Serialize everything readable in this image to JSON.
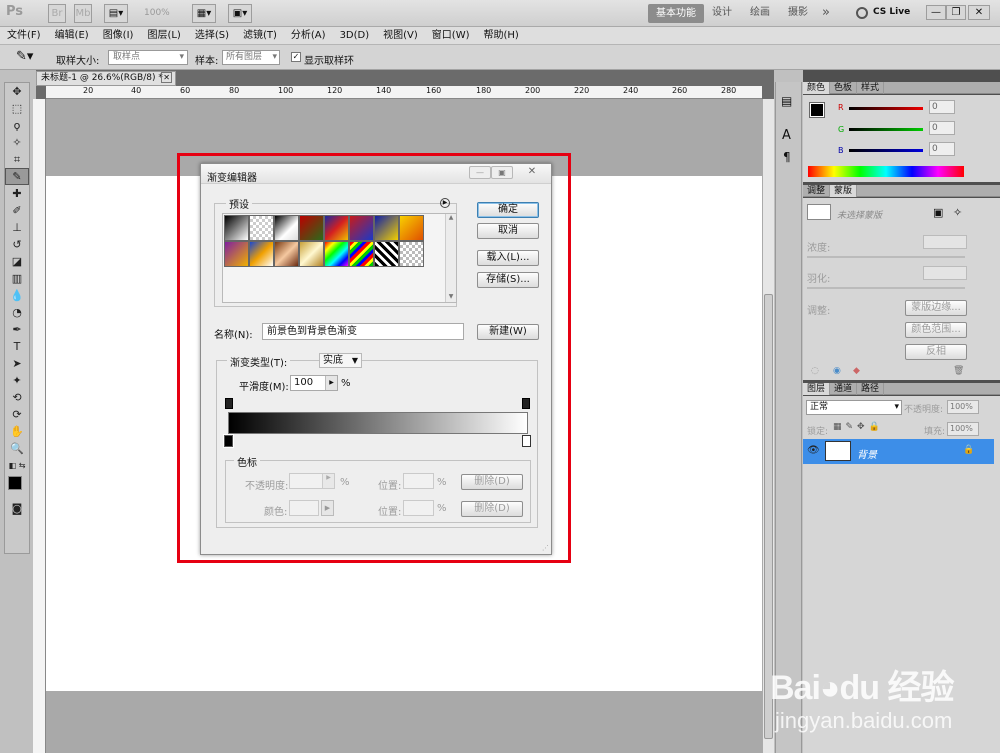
{
  "app": {
    "logo": "Ps",
    "zoom": "100%"
  },
  "workspace": {
    "active": "基本功能",
    "items": [
      "设计",
      "绘画",
      "摄影"
    ],
    "more": "»",
    "cslive": "CS Live"
  },
  "menu": [
    "文件(F)",
    "编辑(E)",
    "图像(I)",
    "图层(L)",
    "选择(S)",
    "滤镜(T)",
    "分析(A)",
    "3D(D)",
    "视图(V)",
    "窗口(W)",
    "帮助(H)"
  ],
  "options": {
    "sample_size_label": "取样大小:",
    "sample_size_value": "取样点",
    "sample_label": "样本:",
    "sample_value": "所有图层",
    "show_ring_label": "显示取样环"
  },
  "document": {
    "tab_title": "未标题-1 @ 26.6%(RGB/8) *",
    "ruler_h": [
      "20",
      "40",
      "60",
      "80",
      "100",
      "120",
      "140",
      "160",
      "180",
      "200",
      "220",
      "240",
      "260",
      "280"
    ]
  },
  "dialog": {
    "title": "渐变编辑器",
    "presets_label": "预设",
    "ok": "确定",
    "cancel": "取消",
    "load": "载入(L)...",
    "save": "存储(S)...",
    "name_label": "名称(N):",
    "name_value": "前景色到背景色渐变",
    "new_btn": "新建(W)",
    "type_label": "渐变类型(T):",
    "type_value": "实底",
    "smooth_label": "平滑度(M):",
    "smooth_value": "100",
    "percent": "%",
    "stops_label": "色标",
    "opacity_label": "不透明度:",
    "location_label": "位置:",
    "delete_btn": "删除(D)",
    "color_label": "颜色:",
    "preset_swatches": [
      "linear-gradient(135deg,#000,#fff)",
      "repeating-conic-gradient(#ccc 0 25%,#fff 0 50%) 0 0/6px 6px",
      "linear-gradient(135deg,#000,#fff 60%,#ddd)",
      "linear-gradient(135deg,#b00,#2a6b1a)",
      "linear-gradient(135deg,#1a2aa0,#d42020,#f0c000)",
      "linear-gradient(135deg,#c81a1a,#1a38c8)",
      "linear-gradient(135deg,#1020a8,#f2d000)",
      "linear-gradient(135deg,#f8d000,#e05000)",
      "linear-gradient(135deg,#8020a0,#f0b000)",
      "linear-gradient(135deg,#1a48d0,#f0a000,#fff)",
      "linear-gradient(135deg,#7a3a10,#f5c8a0,#6a2a10)",
      "linear-gradient(135deg,#c8a038,#fff8d0,#b08020)",
      "linear-gradient(135deg,#f00,#ff0,#0f0,#0ff,#00f,#f0f)",
      "repeating-linear-gradient(135deg,#f00 0 3px,#ff0 3px 6px,#0c0 6px 9px,#00f 9px 12px)",
      "repeating-linear-gradient(45deg,#000 0 3px,#fff 3px 6px)",
      "repeating-conic-gradient(#bbb 0 25%,#fff 0 50%) 0 0/6px 6px"
    ]
  },
  "panels": {
    "color": {
      "tabs": [
        "颜色",
        "色板",
        "样式"
      ],
      "r_label": "R",
      "g_label": "G",
      "b_label": "B",
      "r": "0",
      "g": "0",
      "b": "0"
    },
    "adjust": {
      "tabs": [
        "调整",
        "蒙版"
      ],
      "no_mask": "未选择蒙版",
      "density": "浓度:",
      "feather": "羽化:",
      "refine": "调整:",
      "mask_edge": "蒙版边缘...",
      "color_range": "颜色范围...",
      "invert": "反相"
    },
    "layers": {
      "tabs": [
        "图层",
        "通道",
        "路径"
      ],
      "blend": "正常",
      "opacity_label": "不透明度:",
      "opacity": "100%",
      "lock_label": "锁定:",
      "fill_label": "填充:",
      "fill": "100%",
      "layer_name": "背景"
    }
  },
  "watermark": {
    "brand": "Bai du 经验",
    "url": "jingyan.baidu.com"
  }
}
